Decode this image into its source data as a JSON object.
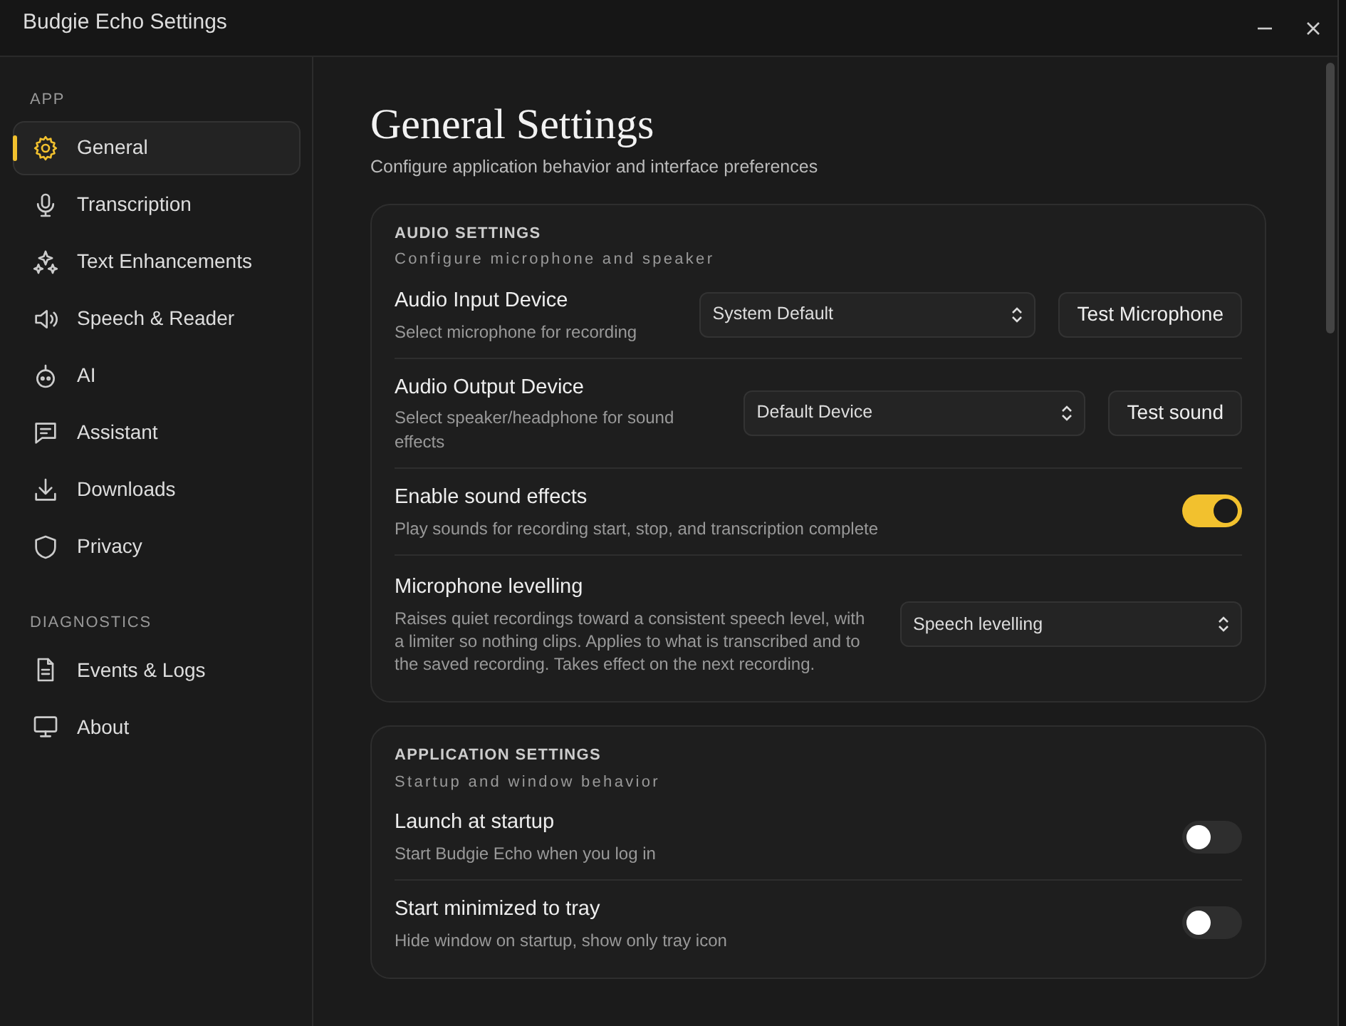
{
  "window": {
    "title": "Budgie Echo Settings",
    "controls": [
      {
        "kind": "minimize"
      },
      {
        "kind": "close"
      }
    ]
  },
  "sidebar": {
    "sections": [
      {
        "heading": "APP",
        "items": [
          {
            "label": "General",
            "kind": "gear",
            "selected": true
          },
          {
            "label": "Transcription",
            "kind": "mic",
            "selected": false
          },
          {
            "label": "Text Enhancements",
            "kind": "sparkles",
            "selected": false
          },
          {
            "label": "Speech & Reader",
            "kind": "speaker",
            "selected": false
          },
          {
            "label": "AI",
            "kind": "robot",
            "selected": false
          },
          {
            "label": "Assistant",
            "kind": "message",
            "selected": false
          },
          {
            "label": "Downloads",
            "kind": "download",
            "selected": false
          },
          {
            "label": "Privacy",
            "kind": "shield",
            "selected": false
          }
        ]
      },
      {
        "heading": "DIAGNOSTICS",
        "items": [
          {
            "label": "Events & Logs",
            "kind": "file",
            "selected": false
          },
          {
            "label": "About",
            "kind": "monitor",
            "selected": false
          }
        ]
      }
    ]
  },
  "page": {
    "title": "General Settings",
    "subtitle": "Configure application behavior and interface preferences"
  },
  "cards": [
    {
      "title": "AUDIO SETTINGS",
      "subtitle": "Configure microphone and speaker",
      "rows": [
        {
          "kind": "select_button",
          "label": "Audio Input Device",
          "description": "Select microphone for recording",
          "value": "System Default",
          "button": "Test Microphone"
        },
        {
          "kind": "select_button",
          "label": "Audio Output Device",
          "description": "Select speaker/headphone for sound effects",
          "value": "Default Device",
          "button": "Test sound"
        },
        {
          "kind": "toggle",
          "label": "Enable sound effects",
          "description": "Play sounds for recording start, stop, and transcription complete",
          "on": true
        },
        {
          "kind": "select",
          "label": "Microphone levelling",
          "description": "Raises quiet recordings toward a consistent speech level, with a limiter so nothing clips. Applies to what is transcribed and to the saved recording. Takes effect on the next recording.",
          "value": "Speech levelling"
        }
      ]
    },
    {
      "title": "APPLICATION SETTINGS",
      "subtitle": "Startup and window behavior",
      "rows": [
        {
          "kind": "toggle",
          "label": "Launch at startup",
          "description": "Start Budgie Echo when you log in",
          "on": false
        },
        {
          "kind": "toggle",
          "label": "Start minimized to tray",
          "description": "Hide window on startup, show only tray icon",
          "on": false
        }
      ]
    }
  ]
}
